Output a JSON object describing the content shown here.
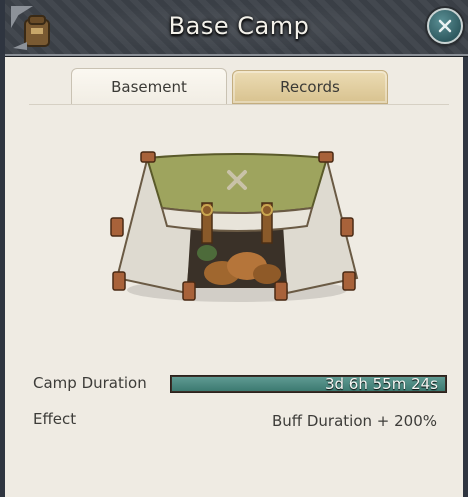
{
  "window": {
    "title": "Base Camp",
    "close_label": "Close"
  },
  "tabs": [
    {
      "label": "Basement",
      "active": true
    },
    {
      "label": "Records",
      "active": false
    }
  ],
  "camp": {
    "duration_label": "Camp Duration",
    "duration_value": "3d 6h 55m 24s",
    "duration_fill_fraction": 1.0,
    "effect_label": "Effect",
    "effect_value": "Buff Duration + 200%"
  },
  "colors": {
    "bar_fill": "#3c7a71",
    "tab_inactive": "#d8c28f",
    "panel_bg": "#efebe3",
    "titlebar_bg": "#3b4048"
  },
  "icons": {
    "corner": "backpack-emblem-icon",
    "close": "close-icon",
    "illustration": "tent-illustration"
  }
}
